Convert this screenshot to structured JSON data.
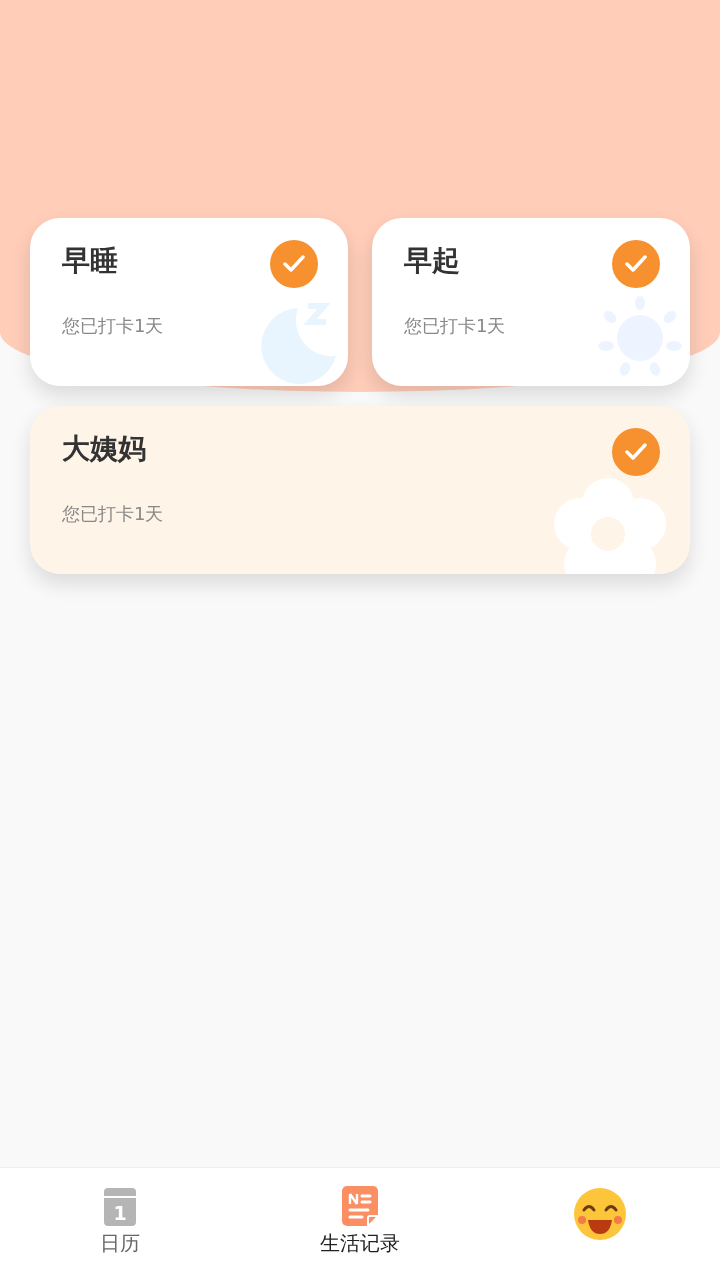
{
  "cards": [
    {
      "title": "早睡",
      "subtitle": "您已打卡1天",
      "checked": true,
      "kind": "moon"
    },
    {
      "title": "早起",
      "subtitle": "您已打卡1天",
      "checked": true,
      "kind": "sun"
    },
    {
      "title": "大姨妈",
      "subtitle": "您已打卡1天",
      "checked": true,
      "kind": "flower"
    }
  ],
  "tabs": [
    {
      "label": "日历",
      "selected": false,
      "kind": "calendar",
      "icon_text": "1"
    },
    {
      "label": "生活记录",
      "selected": true,
      "kind": "notes"
    },
    {
      "selected": false,
      "kind": "face"
    }
  ]
}
